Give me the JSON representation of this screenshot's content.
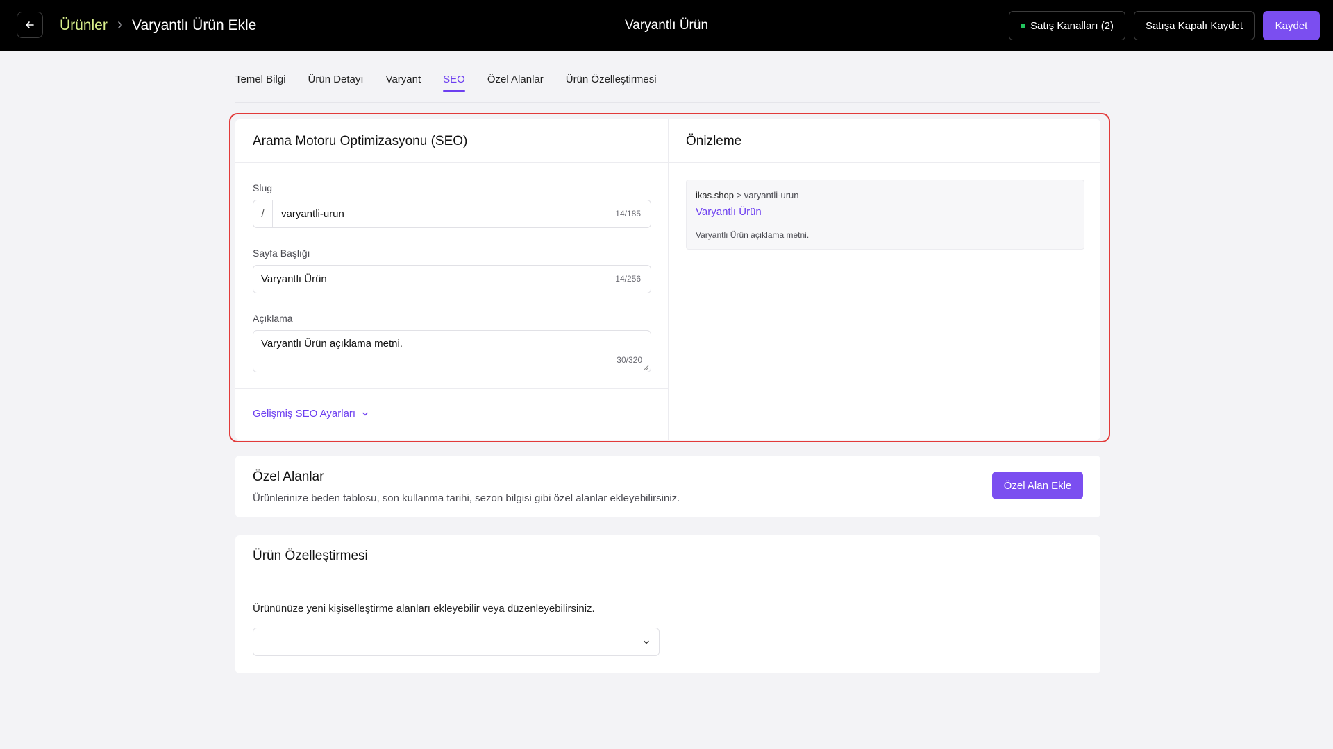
{
  "header": {
    "breadcrumb_parent": "Ürünler",
    "breadcrumb_current": "Varyantlı Ürün Ekle",
    "page_title": "Varyantlı Ürün",
    "sales_channels_label": "Satış Kanalları (2)",
    "save_closed_label": "Satışa Kapalı Kaydet",
    "save_label": "Kaydet"
  },
  "tabs": [
    {
      "label": "Temel Bilgi",
      "active": false
    },
    {
      "label": "Ürün Detayı",
      "active": false
    },
    {
      "label": "Varyant",
      "active": false
    },
    {
      "label": "SEO",
      "active": true
    },
    {
      "label": "Özel Alanlar",
      "active": false
    },
    {
      "label": "Ürün Özelleştirmesi",
      "active": false
    }
  ],
  "seo": {
    "title": "Arama Motoru Optimizasyonu (SEO)",
    "slug": {
      "label": "Slug",
      "prefix": "/",
      "value": "varyantli-urun",
      "count": "14/185"
    },
    "page_title": {
      "label": "Sayfa Başlığı",
      "value": "Varyantlı Ürün",
      "count": "14/256"
    },
    "description": {
      "label": "Açıklama",
      "value": "Varyantlı Ürün açıklama metni.",
      "count": "30/320"
    },
    "advanced_label": "Gelişmiş SEO Ayarları"
  },
  "preview": {
    "title": "Önizleme",
    "domain": "ikas.shop",
    "path": " > varyantli-urun",
    "link_title": "Varyantlı Ürün",
    "description": "Varyantlı Ürün açıklama metni."
  },
  "custom_fields": {
    "title": "Özel Alanlar",
    "description": "Ürünlerinize beden tablosu, son kullanma tarihi, sezon bilgisi gibi özel alanlar ekleyebilirsiniz.",
    "add_button": "Özel Alan Ekle"
  },
  "customization": {
    "title": "Ürün Özelleştirmesi",
    "description": "Ürününüze yeni kişiselleştirme alanları ekleyebilir veya düzenleyebilirsiniz.",
    "select_value": ""
  },
  "colors": {
    "accent": "#7b4ef0",
    "breadcrumb_link": "#d9ef8b",
    "highlight": "#e23a3a",
    "status_green": "#22c55e"
  }
}
